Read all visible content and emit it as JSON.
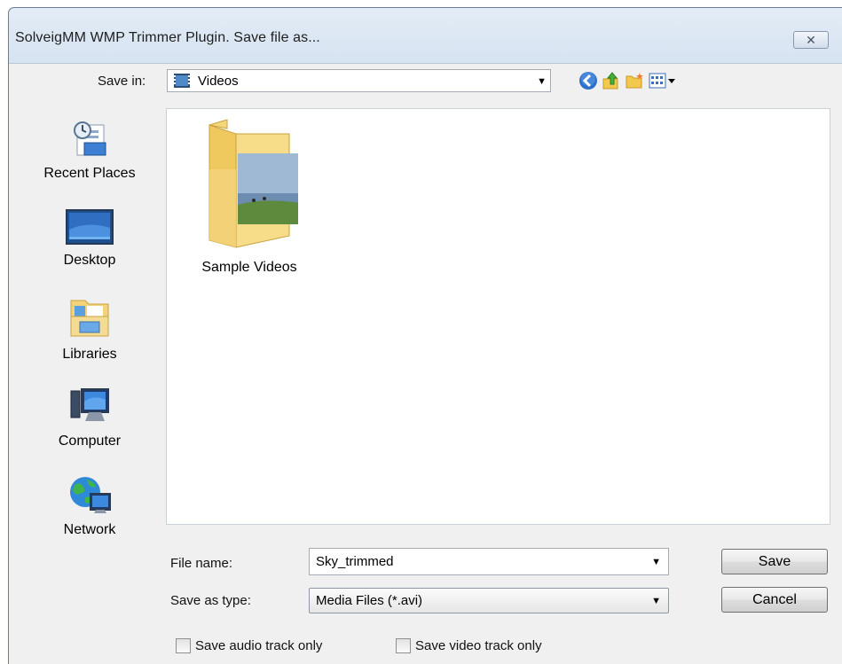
{
  "window": {
    "title": "SolveigMM WMP Trimmer Plugin. Save file as..."
  },
  "toolbar": {
    "save_in_label": "Save in:",
    "save_in_value": "Videos",
    "buttons": [
      "back-icon",
      "up-folder-icon",
      "new-folder-icon",
      "views-menu-icon"
    ]
  },
  "places": [
    {
      "label": "Recent Places",
      "icon": "recent-places-icon"
    },
    {
      "label": "Desktop",
      "icon": "desktop-icon"
    },
    {
      "label": "Libraries",
      "icon": "libraries-icon"
    },
    {
      "label": "Computer",
      "icon": "computer-icon"
    },
    {
      "label": "Network",
      "icon": "network-icon"
    }
  ],
  "files": [
    {
      "label": "Sample Videos",
      "icon": "folder-icon"
    }
  ],
  "form": {
    "file_name_label": "File name:",
    "file_name_value": "Sky_trimmed",
    "save_type_label": "Save as type:",
    "save_type_value": "Media Files (*.avi)",
    "save_button": "Save",
    "cancel_button": "Cancel",
    "audio_only_label": "Save audio track only",
    "video_only_label": "Save video track only"
  },
  "colors": {
    "frame": "#d9e5f2",
    "client": "#f0f0f0",
    "folder": "#f5d67a"
  }
}
